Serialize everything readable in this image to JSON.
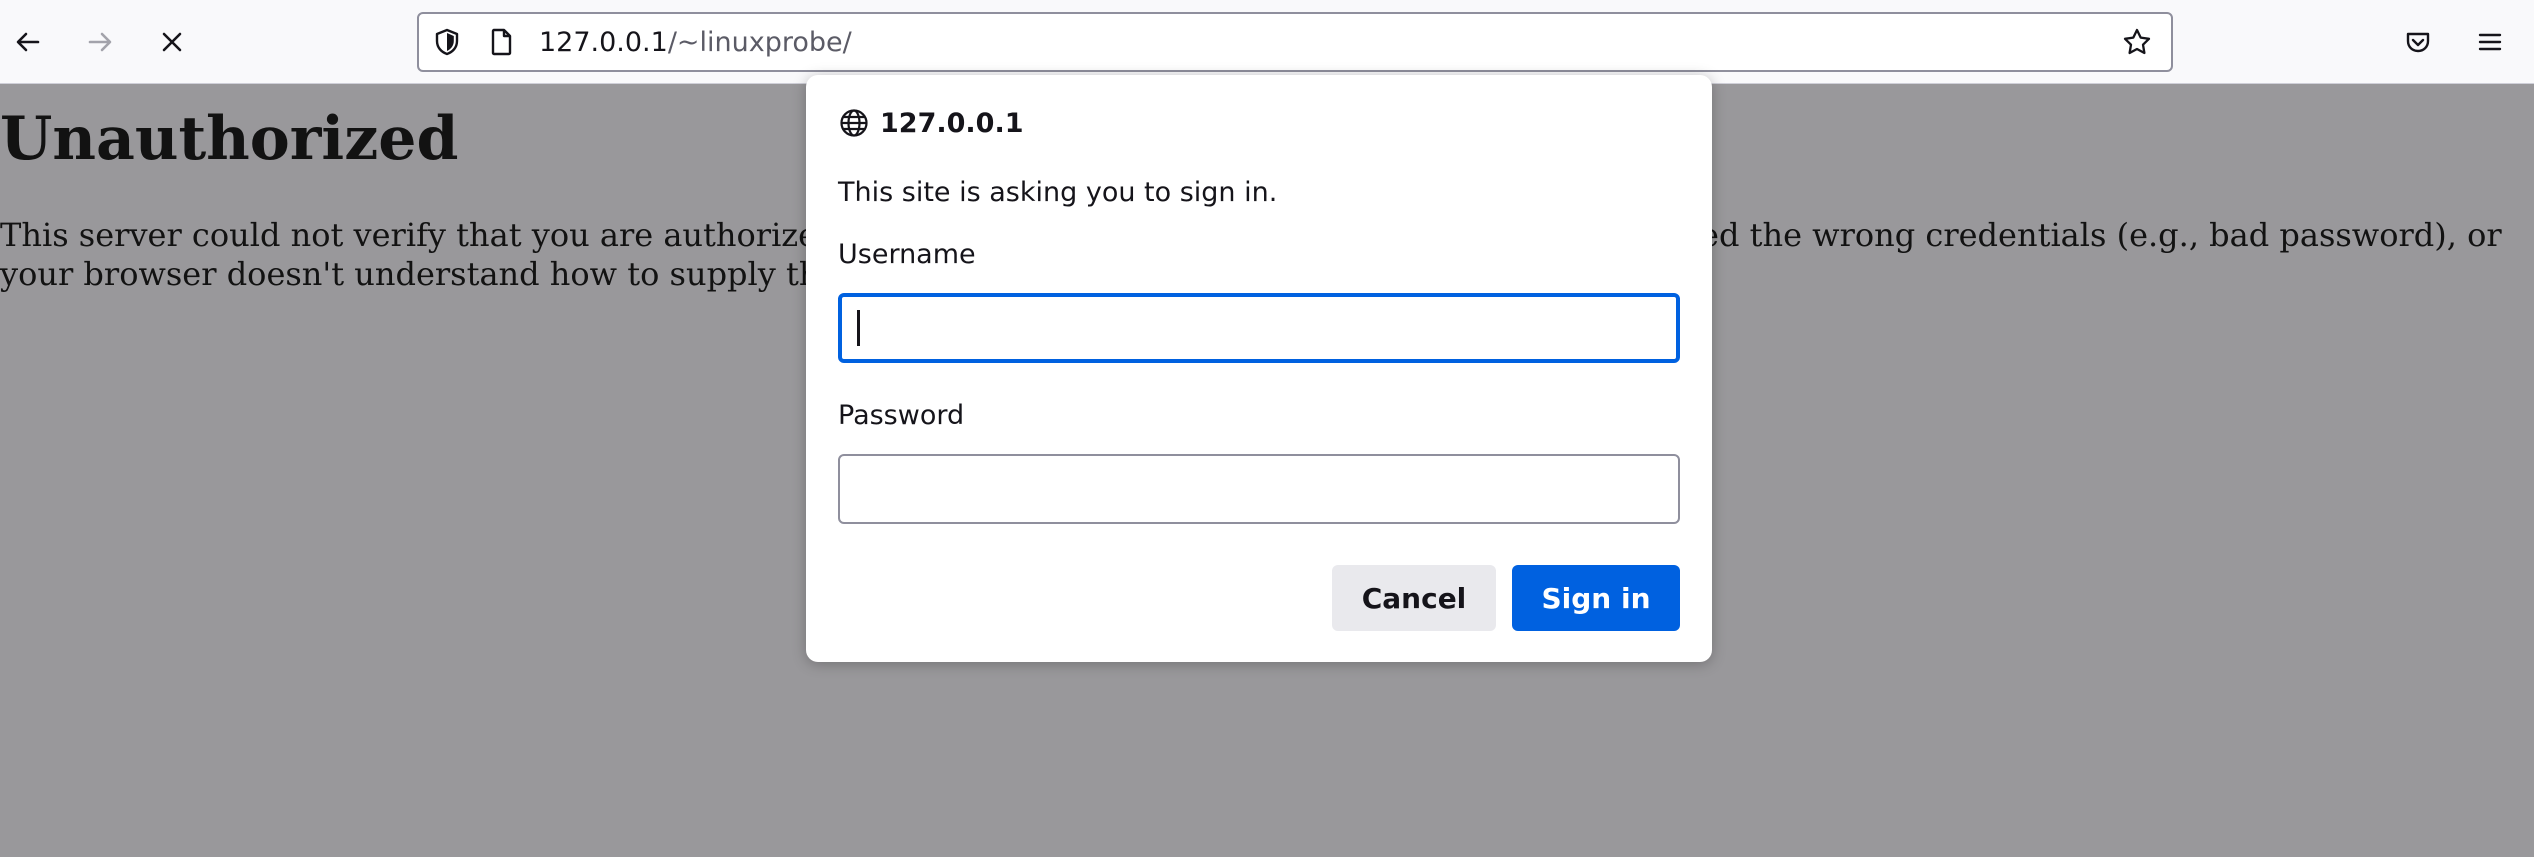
{
  "browser": {
    "url_host": "127.0.0.1",
    "url_path": "/~linuxprobe/",
    "icons": {
      "back": "back-arrow-icon",
      "forward": "forward-arrow-icon",
      "stop": "stop-loading-icon",
      "shield": "shield-icon",
      "page": "page-icon",
      "bookmark": "star-icon",
      "pocket": "pocket-icon",
      "menu": "hamburger-menu-icon"
    }
  },
  "page": {
    "title": "Unauthorized",
    "body_line1_left": "This server could not verify that you are authorize",
    "body_line1_right": "ed the wrong credentials (e.g., bad password), or",
    "body_line2_left": "your browser doesn't understand how to supply th"
  },
  "dialog": {
    "host": "127.0.0.1",
    "message": "This site is asking you to sign in.",
    "username_label": "Username",
    "username_value": "",
    "password_label": "Password",
    "password_value": "",
    "cancel_label": "Cancel",
    "signin_label": "Sign in",
    "icon": "globe-icon"
  },
  "colors": {
    "accent": "#0061e0",
    "overlay_background": "#99989b"
  }
}
